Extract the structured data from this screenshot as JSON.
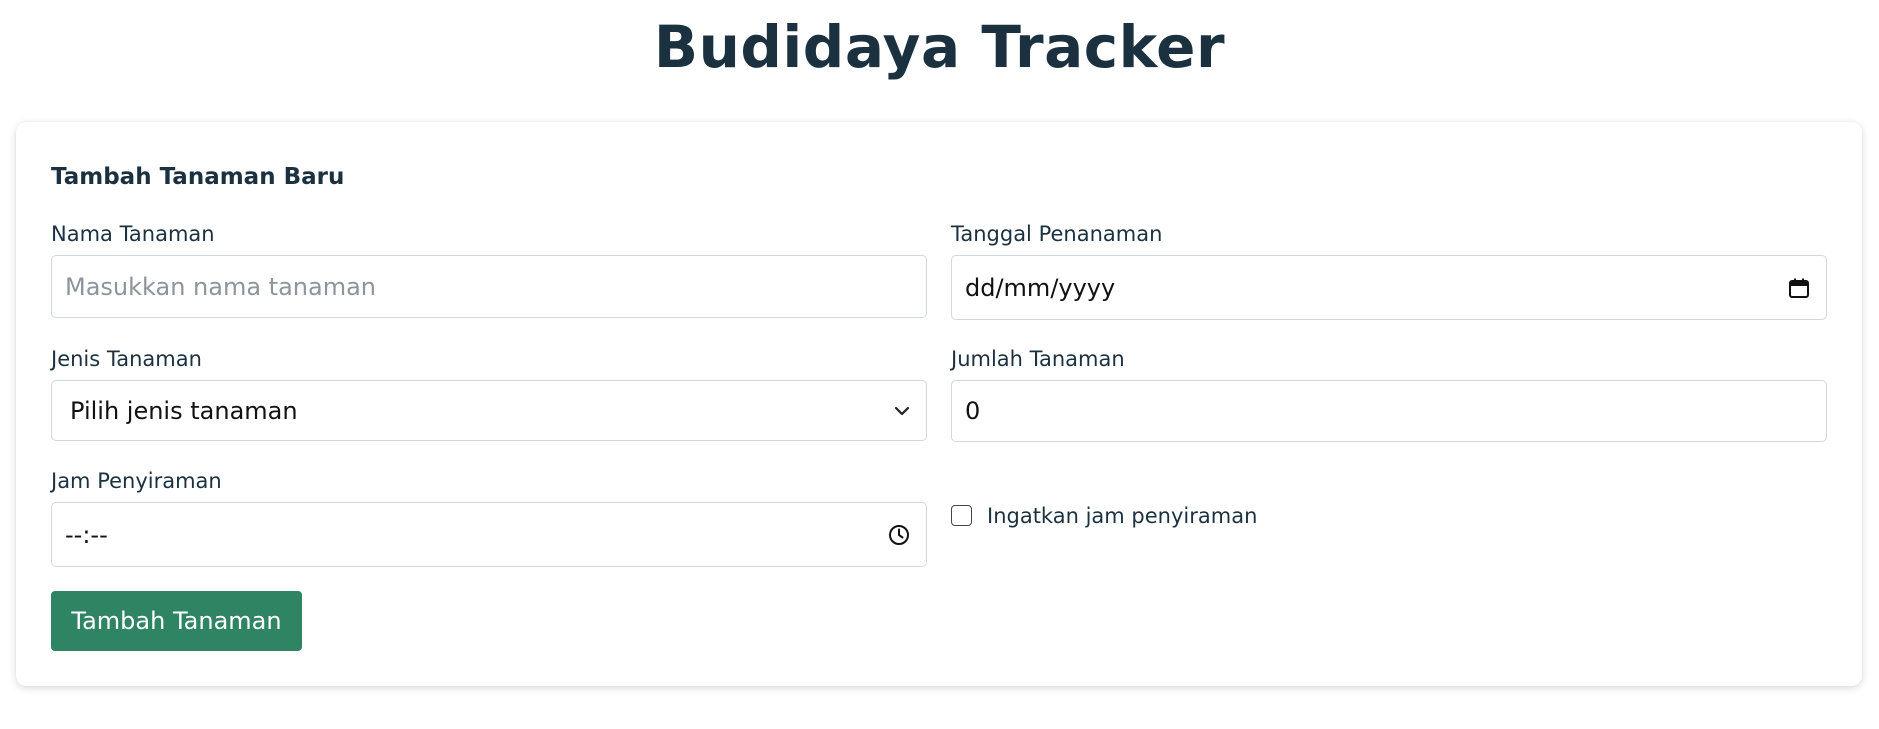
{
  "app": {
    "title": "Budidaya Tracker"
  },
  "form": {
    "title": "Tambah Tanaman Baru",
    "nama_tanaman": {
      "label": "Nama Tanaman",
      "value": "",
      "placeholder": "Masukkan nama tanaman"
    },
    "tanggal_penanaman": {
      "label": "Tanggal Penanaman",
      "value": "dd/mm/yyyy",
      "icon": "calendar-icon"
    },
    "jenis_tanaman": {
      "label": "Jenis Tanaman",
      "selected": "Pilih jenis tanaman",
      "icon": "chevron-down-icon"
    },
    "jumlah_tanaman": {
      "label": "Jumlah Tanaman",
      "value": "0"
    },
    "jam_penyiraman": {
      "label": "Jam Penyiraman",
      "value": "--:--",
      "icon": "clock-icon"
    },
    "reminder": {
      "label": "Ingatkan jam penyiraman",
      "checked": false
    },
    "submit_label": "Tambah Tanaman"
  },
  "colors": {
    "title": "#1b3140",
    "accent": "#2e8463",
    "border": "#d3d8dd",
    "placeholder": "#8d949b"
  }
}
